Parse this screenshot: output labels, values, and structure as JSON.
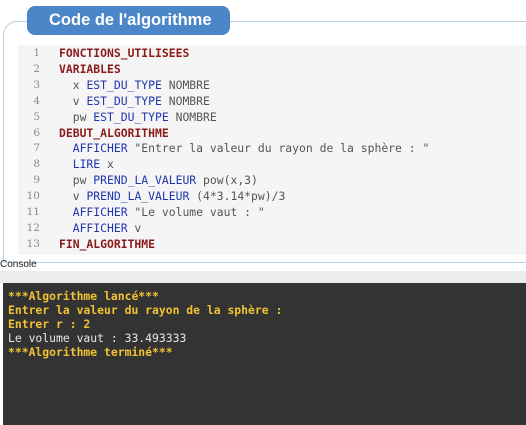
{
  "panel": {
    "title": "Code de l'algorithme"
  },
  "code_lines": [
    {
      "num": "1",
      "parts": [
        {
          "t": "FONCTIONS_UTILISEES",
          "k": "kw"
        }
      ]
    },
    {
      "num": "2",
      "parts": [
        {
          "t": "VARIABLES",
          "k": "kw"
        }
      ]
    },
    {
      "num": "3",
      "parts": [
        {
          "t": "  x ",
          "k": "tx"
        },
        {
          "t": "EST_DU_TYPE",
          "k": "ty"
        },
        {
          "t": " NOMBRE",
          "k": "tx"
        }
      ]
    },
    {
      "num": "4",
      "parts": [
        {
          "t": "  v ",
          "k": "tx"
        },
        {
          "t": "EST_DU_TYPE",
          "k": "ty"
        },
        {
          "t": " NOMBRE",
          "k": "tx"
        }
      ]
    },
    {
      "num": "5",
      "parts": [
        {
          "t": "  pw ",
          "k": "tx"
        },
        {
          "t": "EST_DU_TYPE",
          "k": "ty"
        },
        {
          "t": " NOMBRE",
          "k": "tx"
        }
      ]
    },
    {
      "num": "6",
      "parts": [
        {
          "t": "DEBUT_ALGORITHME",
          "k": "kw"
        }
      ]
    },
    {
      "num": "7",
      "parts": [
        {
          "t": "  AFFICHER",
          "k": "ty"
        },
        {
          "t": " \"Entrer la valeur du rayon de la sphère : \"",
          "k": "tx"
        }
      ]
    },
    {
      "num": "8",
      "parts": [
        {
          "t": "  LIRE",
          "k": "ty"
        },
        {
          "t": " x",
          "k": "tx"
        }
      ]
    },
    {
      "num": "9",
      "parts": [
        {
          "t": "  pw ",
          "k": "tx"
        },
        {
          "t": "PREND_LA_VALEUR",
          "k": "ty"
        },
        {
          "t": " pow(x,3)",
          "k": "tx"
        }
      ]
    },
    {
      "num": "10",
      "parts": [
        {
          "t": "  v ",
          "k": "tx"
        },
        {
          "t": "PREND_LA_VALEUR",
          "k": "ty"
        },
        {
          "t": " (4*3.14*pw)/3",
          "k": "tx"
        }
      ]
    },
    {
      "num": "11",
      "parts": [
        {
          "t": "  AFFICHER",
          "k": "ty"
        },
        {
          "t": " \"Le volume vaut : \"",
          "k": "tx"
        }
      ]
    },
    {
      "num": "12",
      "parts": [
        {
          "t": "  AFFICHER",
          "k": "ty"
        },
        {
          "t": " v",
          "k": "tx"
        }
      ]
    },
    {
      "num": "13",
      "parts": [
        {
          "t": "FIN_ALGORITHME",
          "k": "kw"
        }
      ]
    }
  ],
  "console": {
    "label": "Console",
    "lines": [
      {
        "text": "***Algorithme lancé***",
        "style": "yel"
      },
      {
        "text": "Entrer la valeur du rayon de la sphère :",
        "style": "yel"
      },
      {
        "text": "Entrer r : 2",
        "style": "yel"
      },
      {
        "text": "Le volume vaut : 33.493333",
        "style": "wht"
      },
      {
        "text": "***Algorithme terminé***",
        "style": "yel"
      }
    ]
  }
}
